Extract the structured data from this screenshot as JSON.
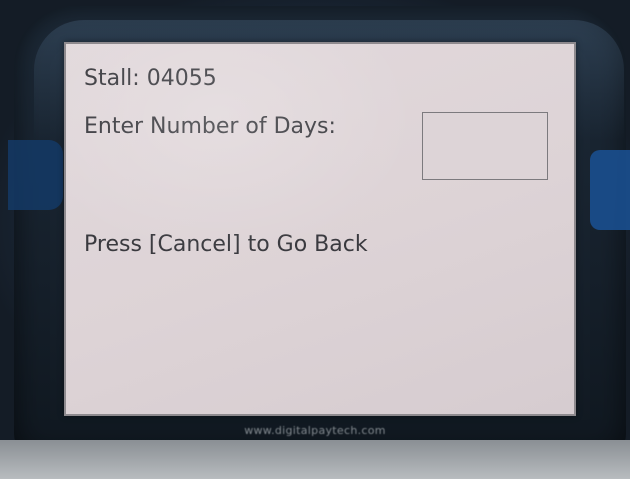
{
  "screen": {
    "stall_label": "Stall: 04055",
    "days_prompt": "Enter Number of Days:",
    "days_value": "",
    "cancel_hint": "Press [Cancel] to Go Back"
  },
  "device": {
    "footer_url": "www.digitalpaytech.com"
  },
  "colors": {
    "screen_bg": "#ddd3d6",
    "text": "#3a3a3f",
    "bezel": "#16202b"
  }
}
